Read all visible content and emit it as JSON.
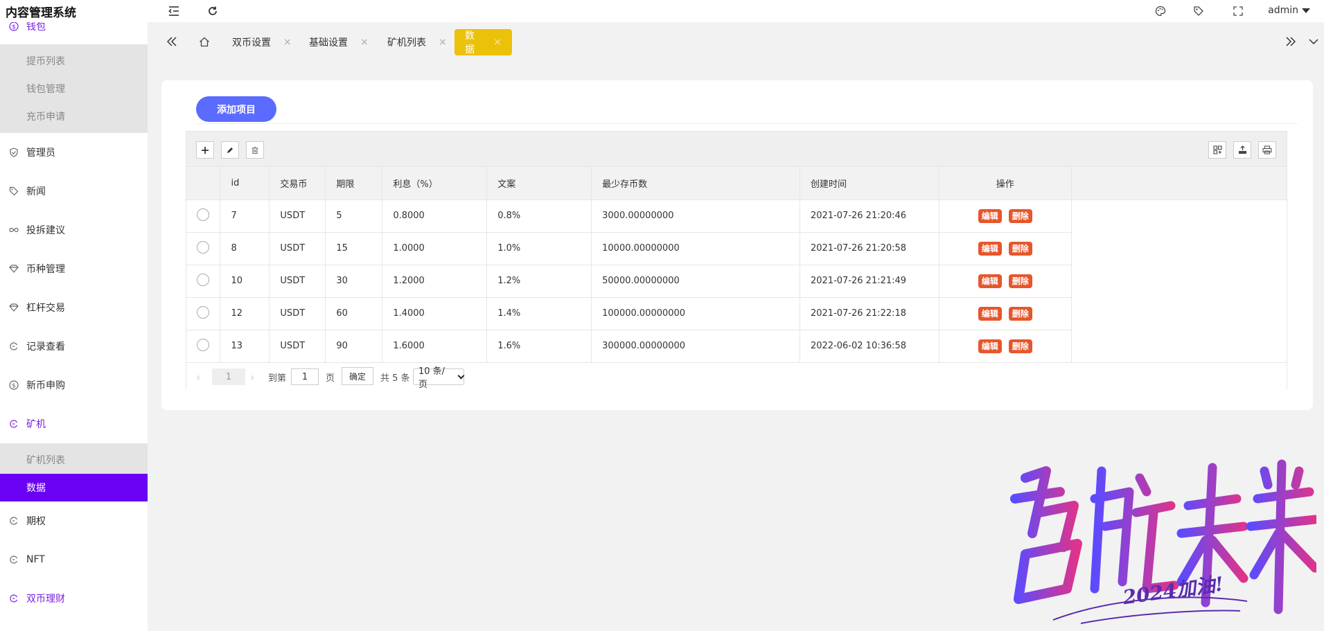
{
  "header": {
    "app_title": "内容管理系统",
    "user": "admin"
  },
  "sidebar": {
    "wallet": {
      "label": "钱包",
      "children": [
        "提币列表",
        "钱包管理",
        "充币申请"
      ]
    },
    "items_a": [
      "管理员",
      "新闻",
      "投拆建议",
      "币种管理",
      "杠杆交易",
      "记录查看",
      "新币申购"
    ],
    "miner": {
      "label": "矿机",
      "children": [
        "矿机列表",
        "数据"
      ],
      "active_child": "数据"
    },
    "items_b": [
      "期权",
      "NFT"
    ],
    "dual": {
      "label": "双币理财"
    }
  },
  "tabs": [
    {
      "label": "双币设置",
      "close": "×"
    },
    {
      "label": "基础设置",
      "close": "×"
    },
    {
      "label": "矿机列表",
      "close": "×"
    },
    {
      "label": "数据",
      "close": "×",
      "active": true
    }
  ],
  "main": {
    "add_button": "添加项目",
    "columns": [
      "id",
      "交易币",
      "期限",
      "利息（%）",
      "文案",
      "最少存币数",
      "创建时间",
      "操作"
    ],
    "rows": [
      [
        "7",
        "USDT",
        "5",
        "0.8000",
        "0.8%",
        "3000.00000000",
        "2021-07-26 21:20:46"
      ],
      [
        "8",
        "USDT",
        "15",
        "1.0000",
        "1.0%",
        "10000.00000000",
        "2021-07-26 21:20:58"
      ],
      [
        "10",
        "USDT",
        "30",
        "1.2000",
        "1.2%",
        "50000.00000000",
        "2021-07-26 21:21:49"
      ],
      [
        "12",
        "USDT",
        "60",
        "1.4000",
        "1.4%",
        "100000.00000000",
        "2021-07-26 21:22:18"
      ],
      [
        "13",
        "USDT",
        "90",
        "1.6000",
        "1.6%",
        "300000.00000000",
        "2022-06-02 10:36:58"
      ]
    ],
    "row_actions": {
      "edit": "编辑",
      "delete": "删除"
    }
  },
  "pager": {
    "current": "1",
    "goto_label": "到第",
    "goto_value": "1",
    "page_unit": "页",
    "confirm": "确定",
    "total": "共 5 条",
    "page_size": "10 条/页"
  },
  "watermark": {
    "main_text": "启航未来",
    "sub_text": "2024加油!",
    "colors": [
      "#5b4bff",
      "#e0338a"
    ]
  },
  "colors": {
    "accent_purple": "#6a00f4",
    "tab_active": "#ebc10a",
    "add_button": "#5b6bff",
    "action_button": "#e6562b"
  }
}
